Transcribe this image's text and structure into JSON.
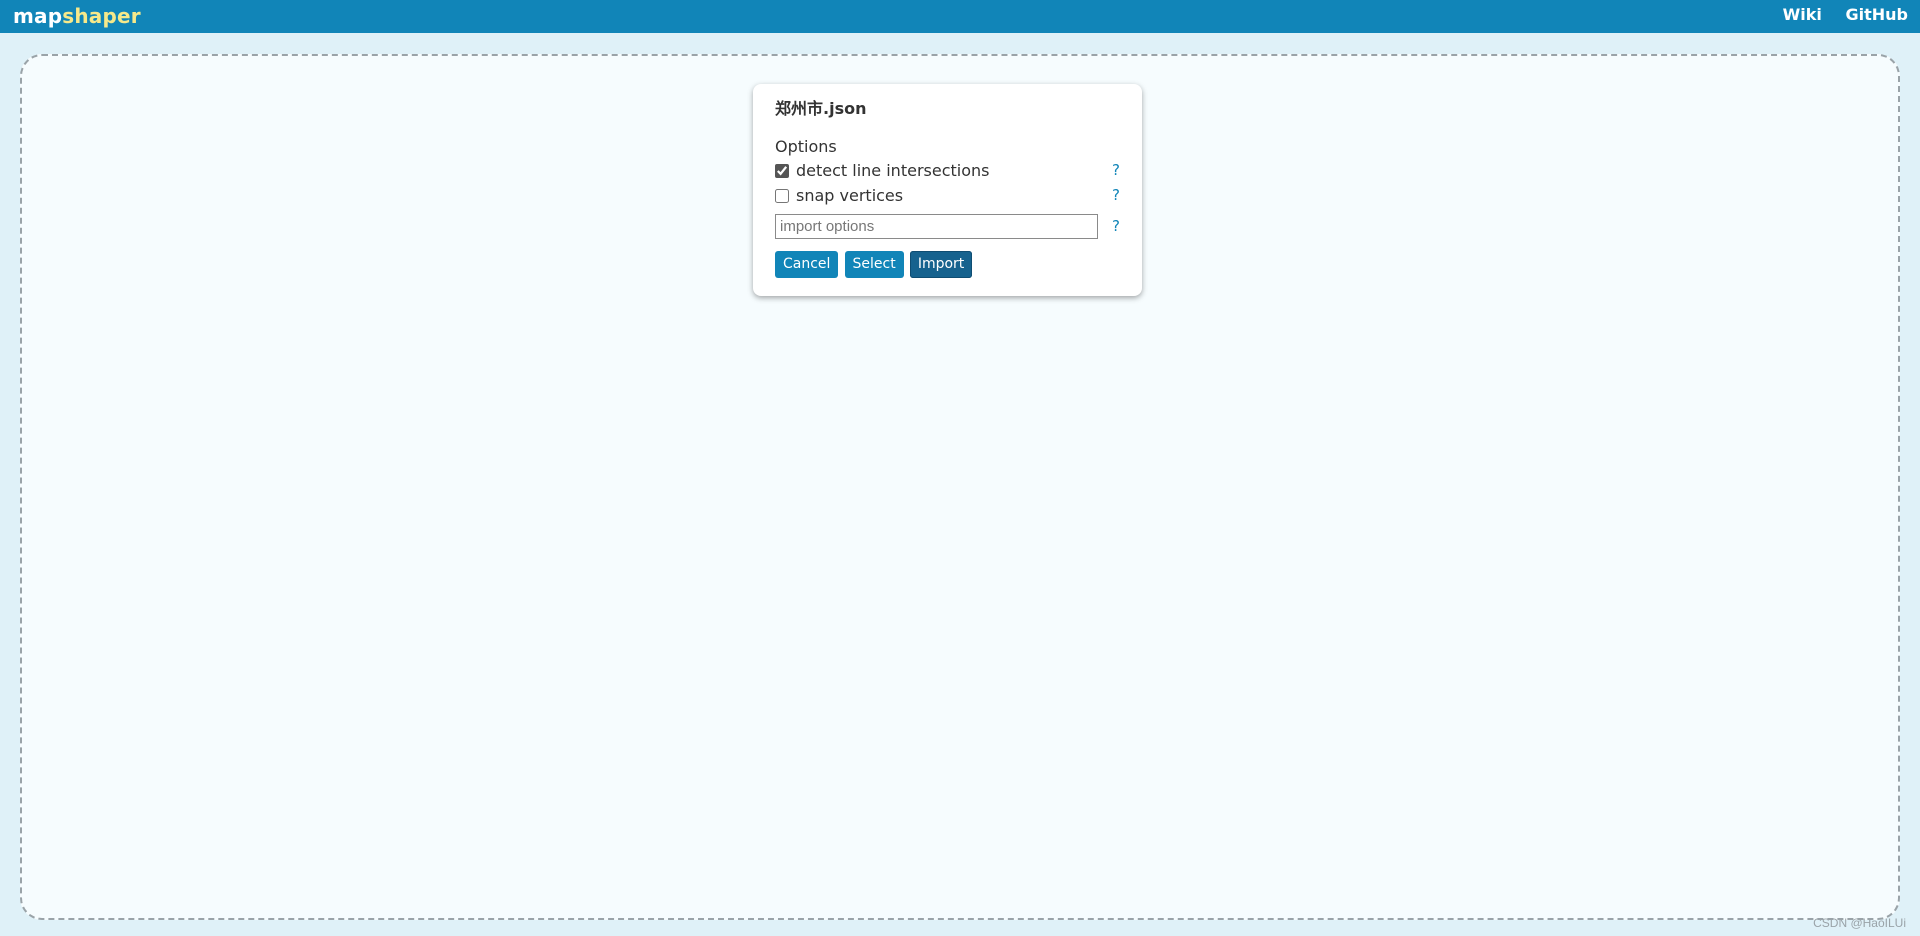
{
  "header": {
    "logo_part1": "map",
    "logo_part2": "shaper",
    "nav": [
      {
        "label": "Wiki"
      },
      {
        "label": "GitHub"
      }
    ]
  },
  "dialog": {
    "file_name": "郑州市.json",
    "options_label": "Options",
    "options": [
      {
        "label": "detect line intersections",
        "checked": true,
        "help": "?"
      },
      {
        "label": "snap vertices",
        "checked": false,
        "help": "?"
      }
    ],
    "import_options": {
      "value": "",
      "placeholder": "import options",
      "help": "?"
    },
    "buttons": {
      "cancel": "Cancel",
      "select": "Select",
      "import": "Import"
    }
  },
  "watermark": "CSDN @HaoILUi",
  "colors": {
    "header_bg": "#1185b8",
    "logo_accent": "#f6e98a",
    "page_bg": "#dff1f8",
    "button_bg": "#1185b8",
    "button_primary_bg": "#16628e"
  }
}
